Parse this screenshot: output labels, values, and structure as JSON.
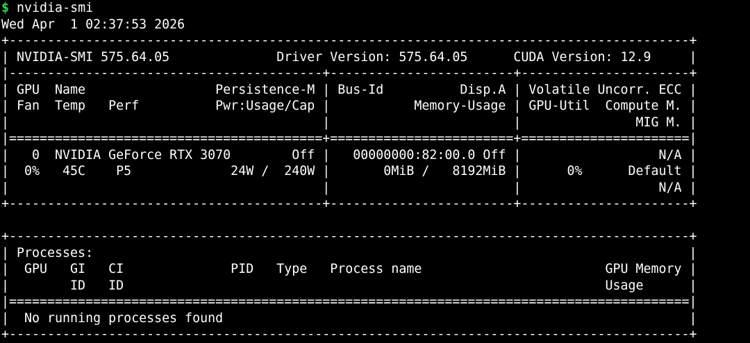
{
  "terminal": {
    "prompt_symbol": "$",
    "command": "nvidia-smi",
    "timestamp": "Wed Apr  1 02:37:53 2026",
    "lines": [
      "+-----------------------------------------------------------------------------------------+",
      "| NVIDIA-SMI 575.64.05              Driver Version: 575.64.05      CUDA Version: 12.9     |",
      "|-----------------------------------------+------------------------+----------------------+",
      "| GPU  Name                 Persistence-M | Bus-Id          Disp.A | Volatile Uncorr. ECC |",
      "| Fan  Temp   Perf          Pwr:Usage/Cap |           Memory-Usage | GPU-Util  Compute M. |",
      "|                                         |                        |               MIG M. |",
      "|=========================================+========================+======================|",
      "|   0  NVIDIA GeForce RTX 3070        Off |   00000000:82:00.0 Off |                  N/A |",
      "|  0%   45C    P5             24W /  240W |       0MiB /   8192MiB |      0%      Default |",
      "|                                         |                        |                  N/A |",
      "+-----------------------------------------+------------------------+----------------------+",
      "",
      "+-----------------------------------------------------------------------------------------+",
      "| Processes:                                                                              |",
      "|  GPU   GI   CI              PID   Type   Process name                        GPU Memory |",
      "|        ID   ID                                                               Usage      |",
      "|=========================================================================================|",
      "|  No running processes found                                                             |",
      "+-----------------------------------------------------------------------------------------+"
    ]
  }
}
